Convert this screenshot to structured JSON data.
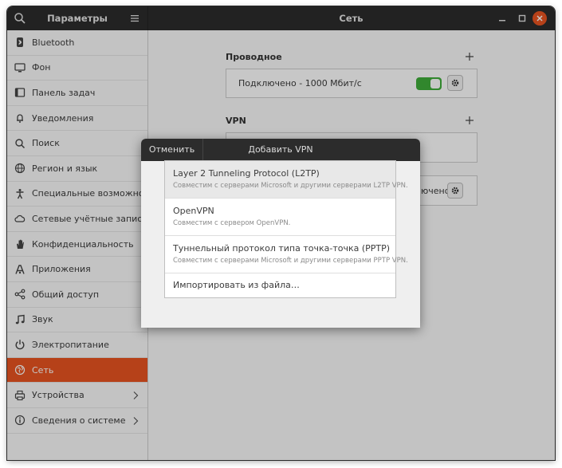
{
  "window": {
    "left_title": "Параметры",
    "title": "Сеть"
  },
  "sidebar": {
    "items": [
      {
        "label": "Bluetooth",
        "icon": "bluetooth-icon"
      },
      {
        "label": "Фон",
        "icon": "background-icon"
      },
      {
        "label": "Панель задач",
        "icon": "dock-icon"
      },
      {
        "label": "Уведомления",
        "icon": "bell-icon"
      },
      {
        "label": "Поиск",
        "icon": "search-icon"
      },
      {
        "label": "Регион и язык",
        "icon": "globe-icon"
      },
      {
        "label": "Специальные возможности",
        "icon": "accessibility-icon"
      },
      {
        "label": "Сетевые учётные записи",
        "icon": "cloud-icon"
      },
      {
        "label": "Конфиденциальность",
        "icon": "hand-icon"
      },
      {
        "label": "Приложения",
        "icon": "apps-icon"
      },
      {
        "label": "Общий доступ",
        "icon": "share-icon"
      },
      {
        "label": "Звук",
        "icon": "music-note-icon"
      },
      {
        "label": "Электропитание",
        "icon": "power-icon"
      },
      {
        "label": "Сеть",
        "icon": "network-icon",
        "active": true
      },
      {
        "label": "Устройства",
        "icon": "printer-icon",
        "chevron": true
      },
      {
        "label": "Сведения о системе",
        "icon": "info-icon",
        "chevron": true
      }
    ]
  },
  "network": {
    "wired": {
      "title": "Проводное",
      "status": "Подключено - 1000 Мбит/с",
      "enabled": true
    },
    "vpn": {
      "title": "VPN"
    },
    "proxy": {
      "status_partial": "ючено"
    }
  },
  "dialog": {
    "cancel_label": "Отменить",
    "title": "Добавить VPN",
    "options": [
      {
        "title": "Layer 2 Tunneling Protocol (L2TP)",
        "desc": "Совместим с серверами Microsoft и другими серверами L2TP VPN."
      },
      {
        "title": "OpenVPN",
        "desc": "Совместим с сервером OpenVPN."
      },
      {
        "title": "Туннельный протокол типа точка-точка (PPTP)",
        "desc": "Совместим с серверами Microsoft и другими серверами PPTP VPN."
      }
    ],
    "import_label": "Импортировать из файла…"
  },
  "colors": {
    "accent": "#e95420",
    "toggle_on": "#3fae3a",
    "headerbar": "#2c2c2c"
  }
}
